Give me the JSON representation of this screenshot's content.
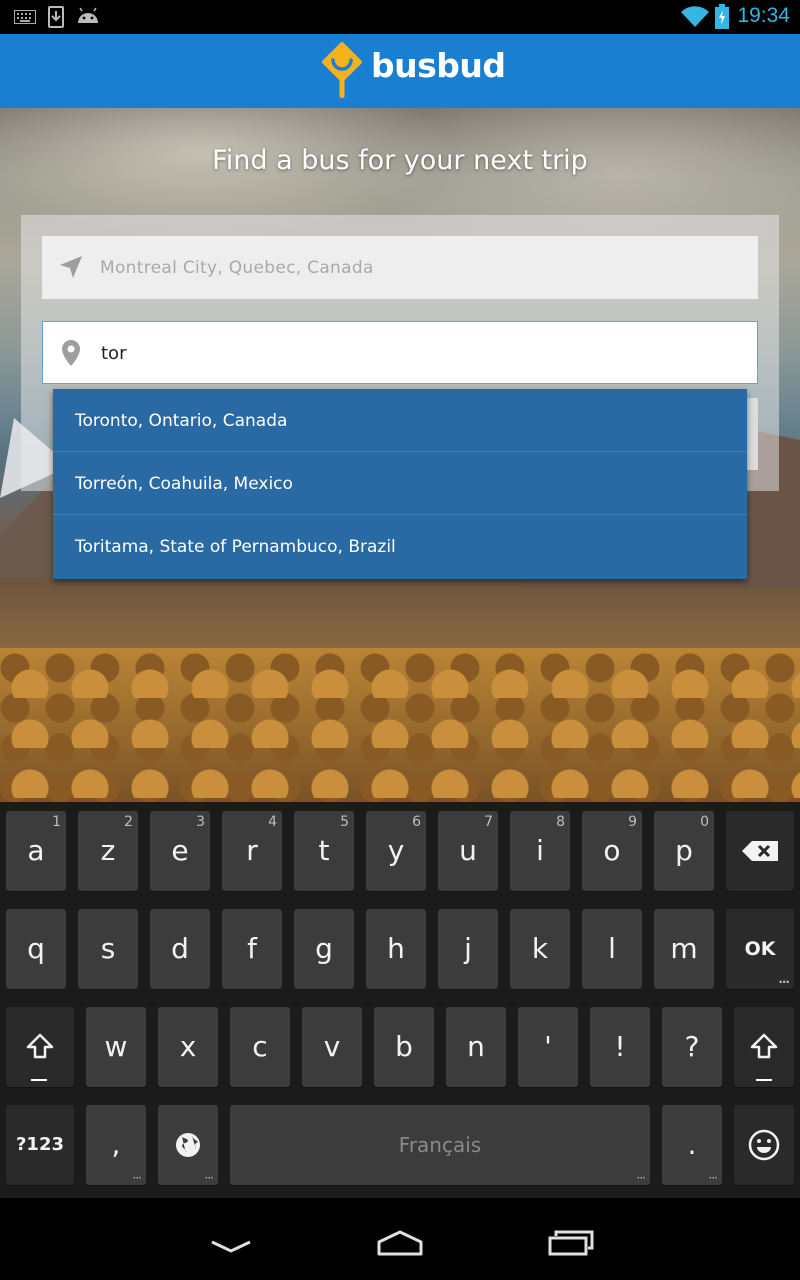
{
  "status_bar": {
    "time": "19:34",
    "icons": [
      "keyboard-icon",
      "download-icon",
      "android-icon",
      "wifi-icon",
      "battery-charging-icon"
    ]
  },
  "app": {
    "brand": "busbud",
    "brand_color": "#1a7fd1",
    "accent_color": "#f5b21b",
    "headline": "Find a bus for your next trip"
  },
  "search": {
    "origin_value": "Montreal City, Quebec, Canada",
    "origin_icon": "navigation-arrow-icon",
    "destination_value": "tor",
    "destination_icon": "map-pin-icon"
  },
  "suggestions": [
    "Toronto, Ontario, Canada",
    "Torreón, Coahuila, Mexico",
    "Toritama, State of Pernambuco, Brazil"
  ],
  "keyboard": {
    "row1": [
      {
        "label": "a",
        "hint": "1"
      },
      {
        "label": "z",
        "hint": "2"
      },
      {
        "label": "e",
        "hint": "3"
      },
      {
        "label": "r",
        "hint": "4"
      },
      {
        "label": "t",
        "hint": "5"
      },
      {
        "label": "y",
        "hint": "6"
      },
      {
        "label": "u",
        "hint": "7"
      },
      {
        "label": "i",
        "hint": "8"
      },
      {
        "label": "o",
        "hint": "9"
      },
      {
        "label": "p",
        "hint": "0"
      }
    ],
    "row2": [
      "q",
      "s",
      "d",
      "f",
      "g",
      "h",
      "j",
      "k",
      "l",
      "m"
    ],
    "row3": [
      "w",
      "x",
      "c",
      "v",
      "b",
      "n",
      "'",
      "!",
      "?"
    ],
    "ok_label": "OK",
    "symbols_label": "?123",
    "comma_label": ",",
    "period_label": ".",
    "space_label": "Français",
    "icons": [
      "backspace-icon",
      "shift-icon",
      "globe-icon",
      "emoji-icon"
    ]
  },
  "nav_bar": {
    "icons": [
      "back-icon",
      "home-icon",
      "recents-icon"
    ]
  }
}
